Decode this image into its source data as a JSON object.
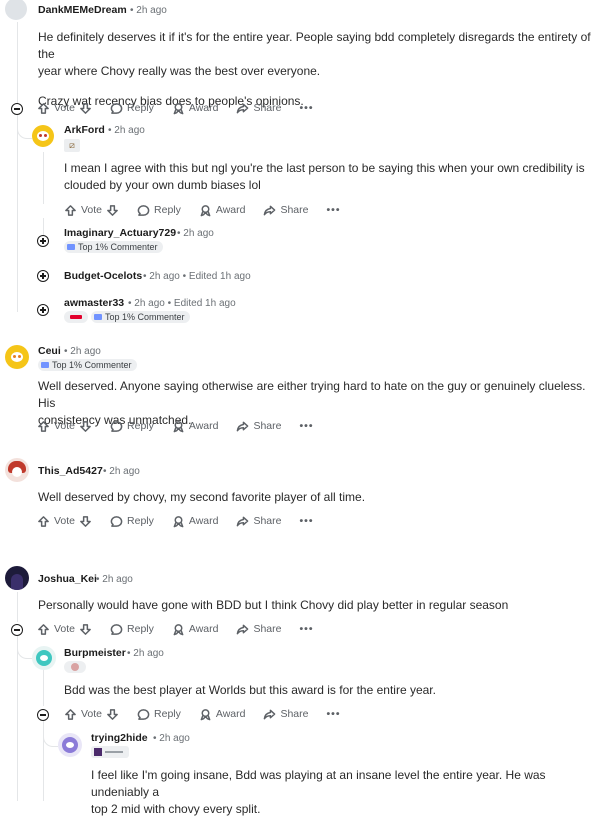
{
  "comments": {
    "dank": {
      "username": "DankMEMeDream",
      "time": "• 2h ago",
      "lines": [
        "He definitely deserves it if it's for the entire year. People saying bdd completely disregards the entirety of the",
        "year where Chovy really was the best over everyone."
      ],
      "line2": "Crazy wat recency bias does to people's opinions."
    },
    "arkford": {
      "username": "ArkFord",
      "time": "• 2h ago",
      "lines": [
        "I mean I agree with this but ngl you're the last person to be saying this when your own credibility is",
        "clouded by your own dumb biases lol"
      ]
    },
    "imaginary": {
      "username": "Imaginary_Actuary729",
      "time": "• 2h ago",
      "flair": "Top 1% Commenter"
    },
    "budget": {
      "username": "Budget-Ocelots",
      "time": "• 2h ago • Edited 1h ago"
    },
    "awmaster": {
      "username": "awmaster33",
      "time": "• 2h ago • Edited 1h ago",
      "flair": "Top 1% Commenter"
    },
    "ceui": {
      "username": "Ceui",
      "time": "• 2h ago",
      "flair": "Top 1% Commenter",
      "lines": [
        "Well deserved. Anyone saying otherwise are either trying hard to hate on the guy or genuinely clueless. His",
        "consistency was unmatched."
      ]
    },
    "this_ad": {
      "username": "This_Ad5427",
      "time": "• 2h ago",
      "lines": [
        "Well deserved by chovy, my second favorite player of all time."
      ]
    },
    "joshua": {
      "username": "Joshua_Kei",
      "time": "• 2h ago",
      "lines": [
        "Personally would have gone with BDD but I think Chovy did play better in regular season"
      ]
    },
    "burp": {
      "username": "Burpmeister",
      "time": "• 2h ago",
      "lines": [
        "Bdd was the best player at Worlds but this award is for the entire year."
      ]
    },
    "trying": {
      "username": "trying2hide",
      "time": "• 2h ago",
      "lines": [
        "I feel like I'm going insane, Bdd was playing at an insane level the entire year. He was undeniably a",
        "top 2 mid with chovy every split."
      ]
    }
  },
  "actions": {
    "vote": "Vote",
    "reply": "Reply",
    "award": "Award",
    "share": "Share",
    "more": "•••"
  },
  "icons": {
    "upvote": "arrow-up-icon",
    "downvote": "arrow-down-icon",
    "reply": "speech-bubble-icon",
    "award": "award-ribbon-icon",
    "share": "share-arrow-icon",
    "more": "ellipsis-icon",
    "collapse": "minus-circle-icon",
    "expand": "plus-circle-icon"
  },
  "colors": {
    "accent_blue": "#7193ff",
    "snoo_yellow": "#f5c518",
    "snoo_teal": "#3fc7c0",
    "snoo_purple": "#8b7bd8"
  }
}
